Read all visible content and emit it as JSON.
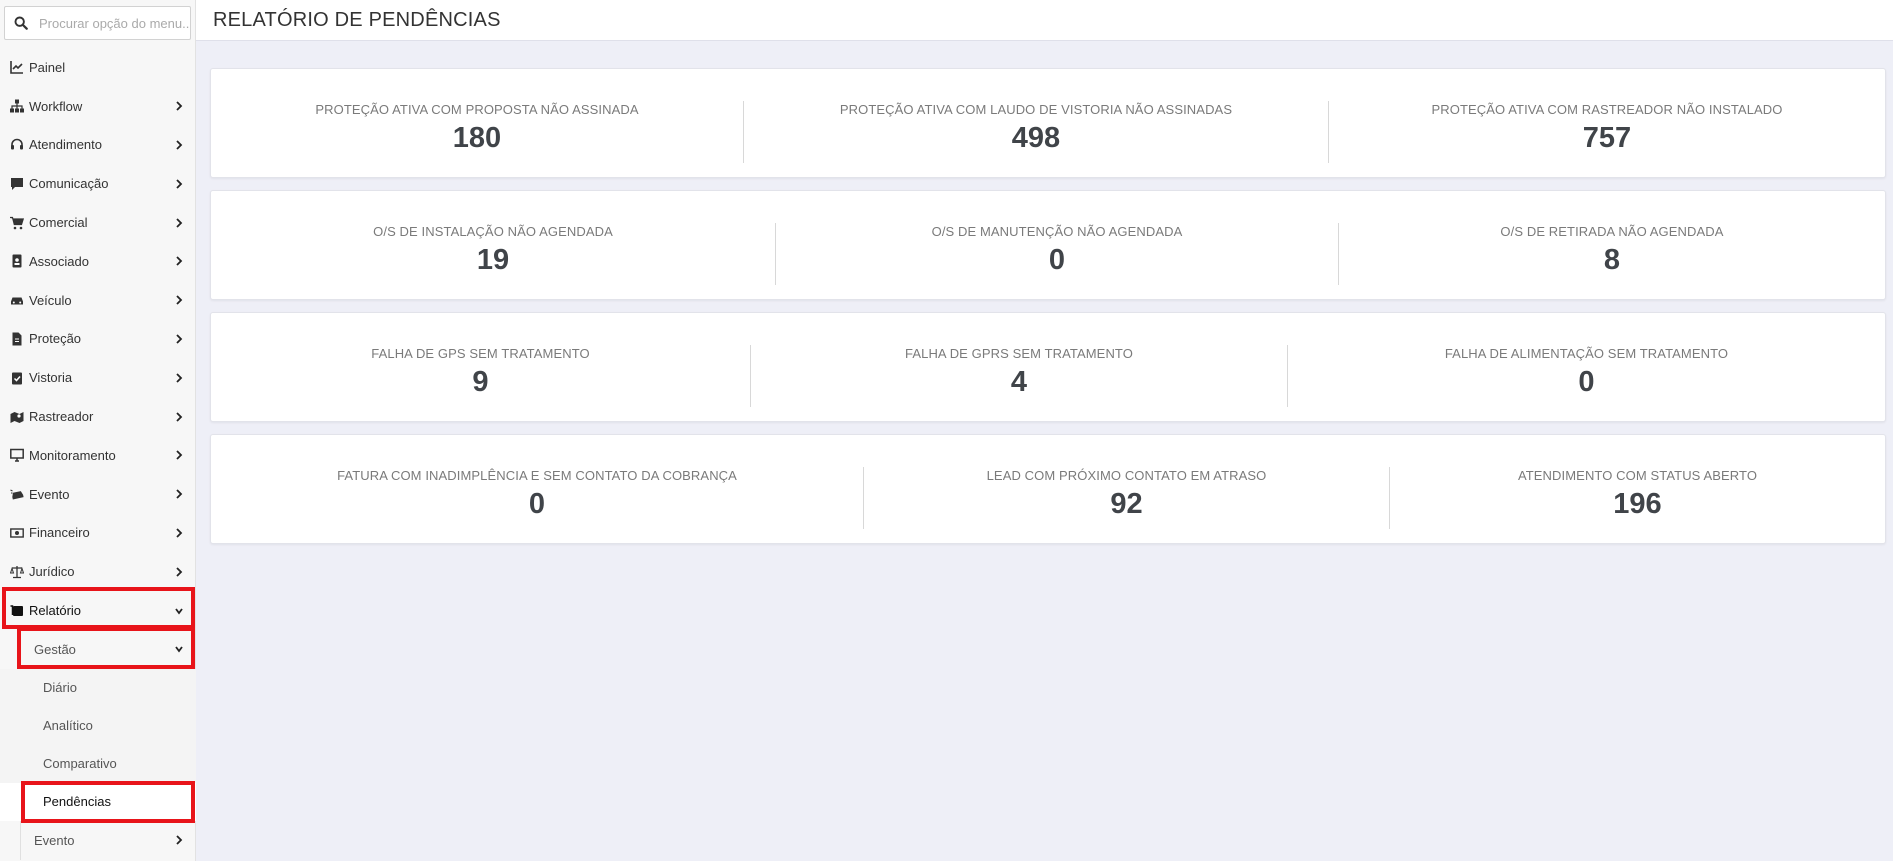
{
  "search": {
    "placeholder": "Procurar opção do menu..."
  },
  "page_title": "RELATÓRIO DE PENDÊNCIAS",
  "sidebar": {
    "items": [
      {
        "label": "Painel",
        "icon": "chart-line-icon",
        "chevron": false
      },
      {
        "label": "Workflow",
        "icon": "sitemap-icon",
        "chevron": true
      },
      {
        "label": "Atendimento",
        "icon": "headset-icon",
        "chevron": true
      },
      {
        "label": "Comunicação",
        "icon": "comment-icon",
        "chevron": true
      },
      {
        "label": "Comercial",
        "icon": "cart-icon",
        "chevron": true
      },
      {
        "label": "Associado",
        "icon": "id-badge-icon",
        "chevron": true
      },
      {
        "label": "Veículo",
        "icon": "car-icon",
        "chevron": true
      },
      {
        "label": "Proteção",
        "icon": "file-icon",
        "chevron": true
      },
      {
        "label": "Vistoria",
        "icon": "clipboard-check-icon",
        "chevron": true
      },
      {
        "label": "Rastreador",
        "icon": "map-marker-icon",
        "chevron": true
      },
      {
        "label": "Monitoramento",
        "icon": "desktop-icon",
        "chevron": true
      },
      {
        "label": "Evento",
        "icon": "car-crash-icon",
        "chevron": true
      },
      {
        "label": "Financeiro",
        "icon": "money-icon",
        "chevron": true
      },
      {
        "label": "Jurídico",
        "icon": "scale-icon",
        "chevron": true
      },
      {
        "label": "Relatório",
        "icon": "report-icon",
        "chevron": true,
        "expanded": true
      }
    ],
    "relatorio_sub": {
      "gestao_label": "Gestão",
      "gestao_items": [
        "Diário",
        "Analítico",
        "Comparativo",
        "Pendências"
      ],
      "evento_label": "Evento"
    }
  },
  "cards": [
    [
      {
        "label": "PROTEÇÃO ATIVA COM PROPOSTA NÃO ASSINADA",
        "value": "180"
      },
      {
        "label": "PROTEÇÃO ATIVA COM LAUDO DE VISTORIA NÃO ASSINADAS",
        "value": "498"
      },
      {
        "label": "PROTEÇÃO ATIVA COM RASTREADOR NÃO INSTALADO",
        "value": "757"
      }
    ],
    [
      {
        "label": "O/S DE INSTALAÇÃO NÃO AGENDADA",
        "value": "19"
      },
      {
        "label": "O/S DE MANUTENÇÃO NÃO AGENDADA",
        "value": "0"
      },
      {
        "label": "O/S DE RETIRADA NÃO AGENDADA",
        "value": "8"
      }
    ],
    [
      {
        "label": "FALHA DE GPS SEM TRATAMENTO",
        "value": "9"
      },
      {
        "label": "FALHA DE GPRS SEM TRATAMENTO",
        "value": "4"
      },
      {
        "label": "FALHA DE ALIMENTAÇÃO SEM TRATAMENTO",
        "value": "0"
      }
    ],
    [
      {
        "label": "FATURA COM INADIMPLÊNCIA E SEM CONTATO DA COBRANÇA",
        "value": "0"
      },
      {
        "label": "LEAD COM PRÓXIMO CONTATO EM ATRASO",
        "value": "92"
      },
      {
        "label": "ATENDIMENTO COM STATUS ABERTO",
        "value": "196"
      }
    ]
  ],
  "colors": {
    "highlight": "#e8141a",
    "background": "#eeeff7",
    "value_text": "#404449"
  }
}
